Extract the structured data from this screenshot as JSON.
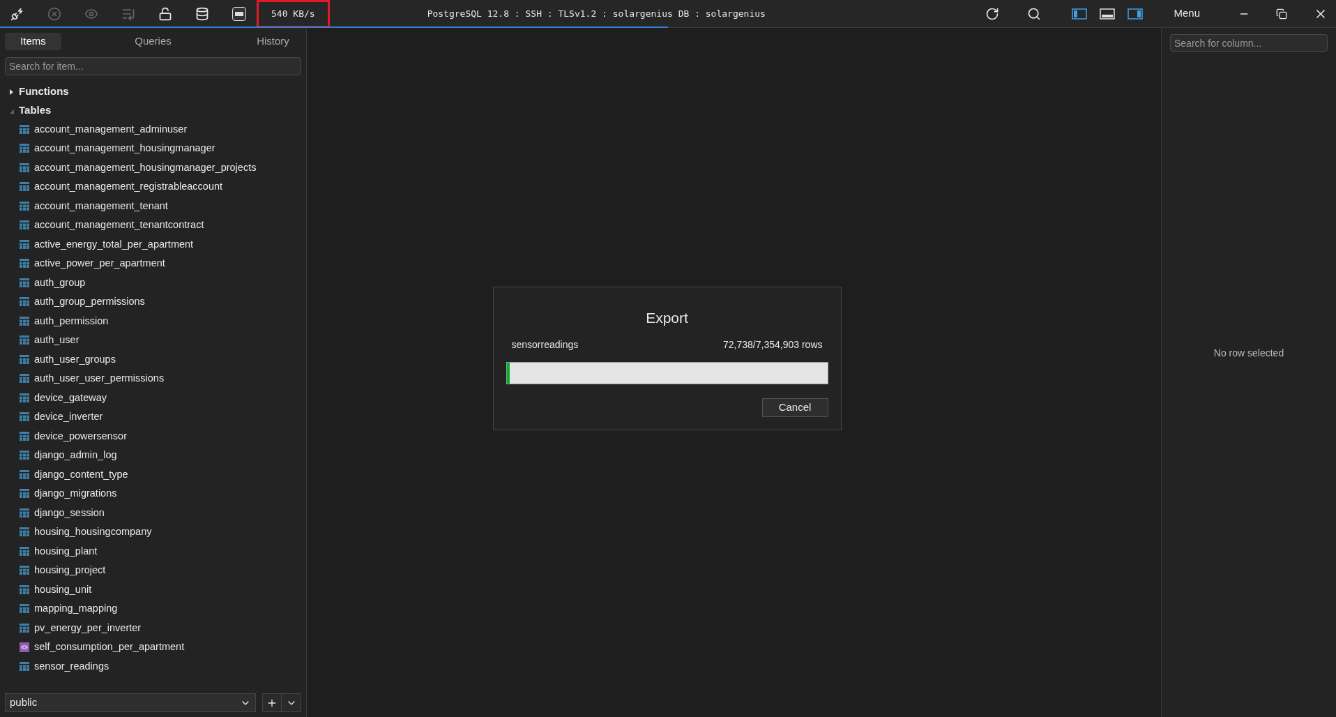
{
  "toolbar": {
    "speed": "540 KB/s",
    "speed_highlighted": true,
    "connection": "PostgreSQL 12.8 : SSH : TLSv1.2 : solargenius DB : solargenius",
    "menu": "Menu",
    "loading": {
      "level": 0.5
    },
    "layout_toggles": [
      {
        "kind": "left",
        "on": true
      },
      {
        "kind": "bottom",
        "on": false
      },
      {
        "kind": "right",
        "on": true
      }
    ]
  },
  "sidebar": {
    "tabs": [
      {
        "label": "Items",
        "selected": true
      },
      {
        "label": "Queries",
        "selected": false
      },
      {
        "label": "History",
        "selected": false
      }
    ],
    "search": {
      "placeholder": "Search for item..."
    },
    "groups": [
      {
        "label": "Functions",
        "expanded": false
      },
      {
        "label": "Tables",
        "expanded": true,
        "children": [
          {
            "name": "account_management_adminuser",
            "kind": "table"
          },
          {
            "name": "account_management_housingmanager",
            "kind": "table"
          },
          {
            "name": "account_management_housingmanager_projects",
            "kind": "table"
          },
          {
            "name": "account_management_registrableaccount",
            "kind": "table"
          },
          {
            "name": "account_management_tenant",
            "kind": "table"
          },
          {
            "name": "account_management_tenantcontract",
            "kind": "table"
          },
          {
            "name": "active_energy_total_per_apartment",
            "kind": "table"
          },
          {
            "name": "active_power_per_apartment",
            "kind": "table"
          },
          {
            "name": "auth_group",
            "kind": "table"
          },
          {
            "name": "auth_group_permissions",
            "kind": "table"
          },
          {
            "name": "auth_permission",
            "kind": "table"
          },
          {
            "name": "auth_user",
            "kind": "table"
          },
          {
            "name": "auth_user_groups",
            "kind": "table"
          },
          {
            "name": "auth_user_user_permissions",
            "kind": "table"
          },
          {
            "name": "device_gateway",
            "kind": "table"
          },
          {
            "name": "device_inverter",
            "kind": "table"
          },
          {
            "name": "device_powersensor",
            "kind": "table"
          },
          {
            "name": "django_admin_log",
            "kind": "table"
          },
          {
            "name": "django_content_type",
            "kind": "table"
          },
          {
            "name": "django_migrations",
            "kind": "table"
          },
          {
            "name": "django_session",
            "kind": "table"
          },
          {
            "name": "housing_housingcompany",
            "kind": "table"
          },
          {
            "name": "housing_plant",
            "kind": "table"
          },
          {
            "name": "housing_project",
            "kind": "table"
          },
          {
            "name": "housing_unit",
            "kind": "table"
          },
          {
            "name": "mapping_mapping",
            "kind": "table"
          },
          {
            "name": "pv_energy_per_inverter",
            "kind": "table"
          },
          {
            "name": "self_consumption_per_apartment",
            "kind": "view"
          },
          {
            "name": "sensor_readings",
            "kind": "table"
          }
        ]
      }
    ],
    "schema": "public"
  },
  "dialog": {
    "title": "Export",
    "table": "sensorreadings",
    "count": "72,738/7,354,903 rows",
    "progress": {
      "level": 0.01
    },
    "cancel": "Cancel"
  },
  "details": {
    "search": {
      "placeholder": "Search for column..."
    },
    "empty": "No row selected"
  }
}
